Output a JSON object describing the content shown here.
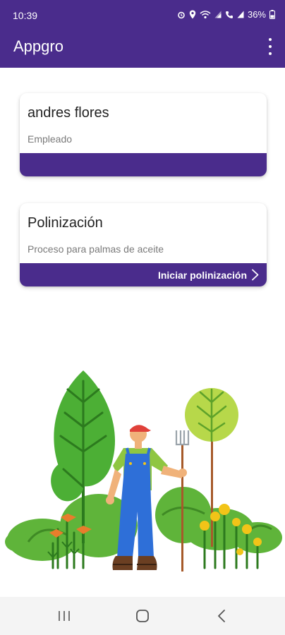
{
  "status_bar": {
    "time": "10:39",
    "battery": "36%",
    "icons": [
      "alarm-icon",
      "location-icon",
      "wifi-icon",
      "signal-icon",
      "call-icon",
      "signal-icon",
      "battery-icon"
    ]
  },
  "app_bar": {
    "title": "Appgro",
    "menu_icon": "more-vert-icon"
  },
  "user_card": {
    "name": "andres flores",
    "role": "Empleado"
  },
  "process_card": {
    "title": "Polinización",
    "description": "Proceso para palmas de aceite",
    "action_label": "Iniciar polinización",
    "action_icon": "chevron-right-icon"
  },
  "nav_bar": {
    "buttons": [
      "recents-icon",
      "home-icon",
      "back-icon"
    ]
  },
  "colors": {
    "primary": "#4a2c8c",
    "background": "#ffffff",
    "nav_background": "#f4f4f4"
  }
}
